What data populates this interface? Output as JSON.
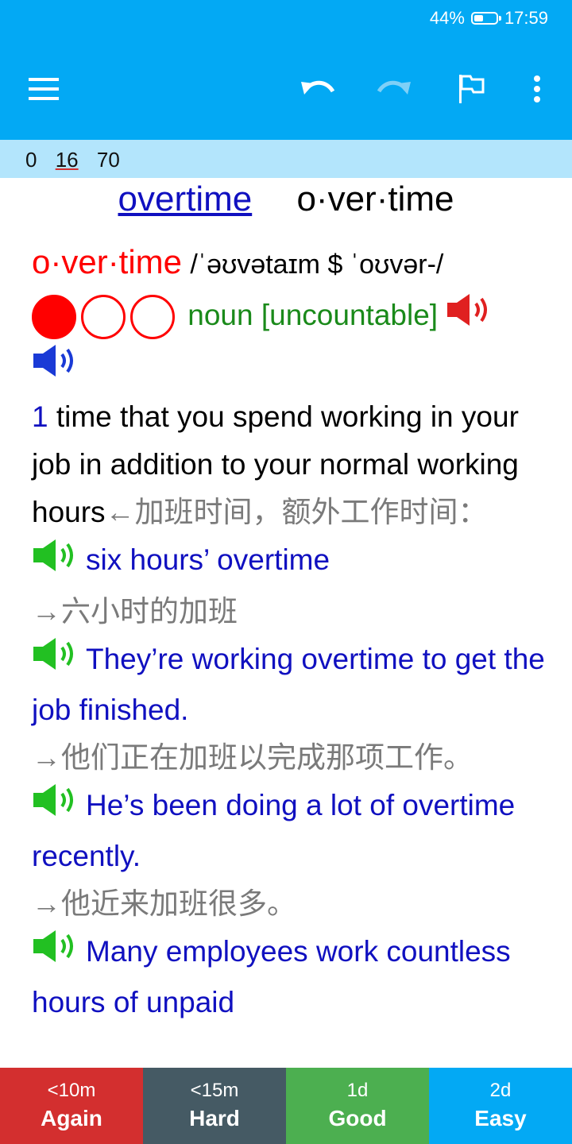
{
  "status": {
    "battery": "44%",
    "battery_level": 0.44,
    "time": "17:59"
  },
  "toolbar": {
    "menu_icon": "hamburger-menu-icon",
    "undo_icon": "undo-icon",
    "redo_icon": "redo-icon",
    "flag_icon": "flag-icon",
    "more_icon": "more-vert-icon"
  },
  "counts": {
    "new": "0",
    "learning": "16",
    "review": "70"
  },
  "card": {
    "word_link": "overtime",
    "hyphenated": "o·ver·time",
    "headword": "o·ver·time",
    "pronunciation": "/ˈəʊvətaɪm $ ˈoʊvər-/",
    "frequency_filled": 1,
    "frequency_total": 3,
    "pos": "noun [uncountable]",
    "sense_number": "1",
    "definition": "time that you spend working in your job in addition to your normal working hours",
    "definition_cn": "←加班时间，额外工作时间：",
    "examples": [
      {
        "en": "six hours’ overtime",
        "cn": "→六小时的加班"
      },
      {
        "en": "They’re working overtime to get the job finished.",
        "cn": "→他们正在加班以完成那项工作。"
      },
      {
        "en": "He’s been doing a lot of overtime recently.",
        "cn": "→他近来加班很多。"
      },
      {
        "en": "Many employees work countless hours of unpaid",
        "cn": ""
      }
    ]
  },
  "answers": [
    {
      "interval": "<10m",
      "label": "Again",
      "color": "#D32F2F"
    },
    {
      "interval": "<15m",
      "label": "Hard",
      "color": "#455A64"
    },
    {
      "interval": "1d",
      "label": "Good",
      "color": "#4CAF50"
    },
    {
      "interval": "2d",
      "label": "Easy",
      "color": "#03A9F4"
    }
  ]
}
